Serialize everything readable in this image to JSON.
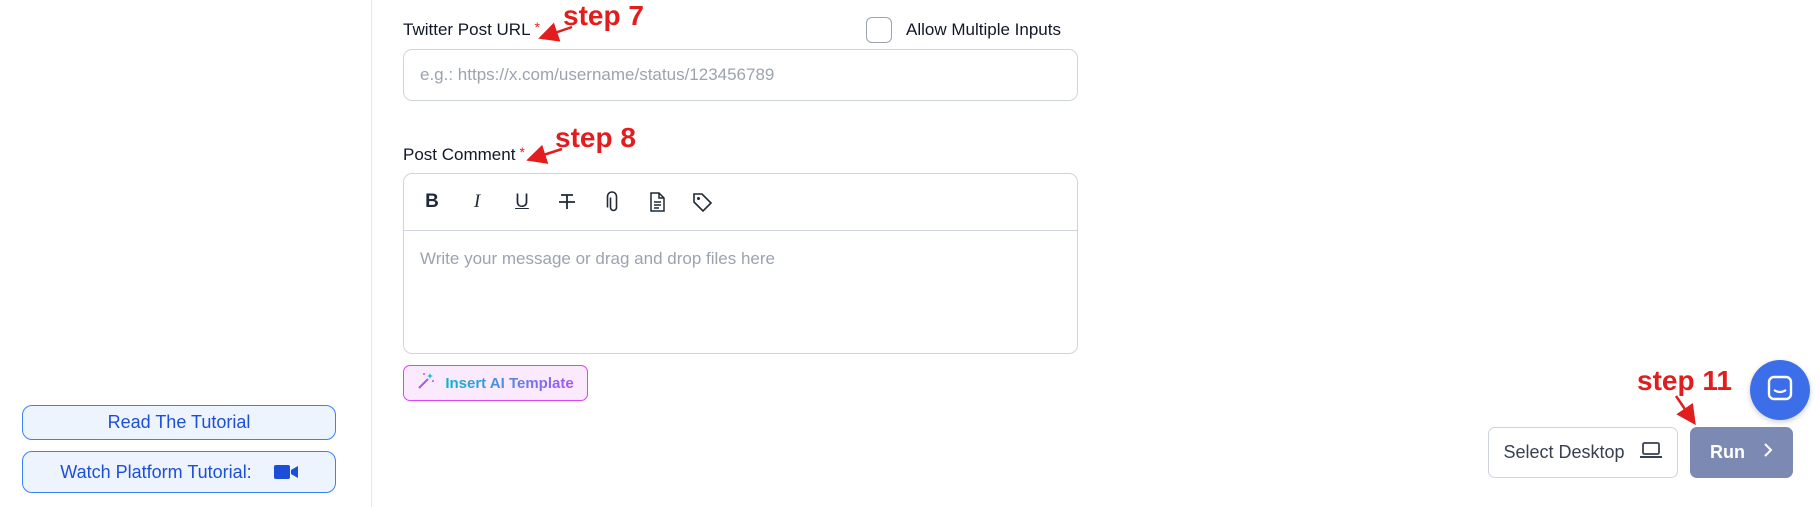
{
  "sidebar": {
    "read_tutorial_label": "Read The Tutorial",
    "watch_platform_label": "Watch Platform Tutorial:"
  },
  "form": {
    "url_label": "Twitter Post URL",
    "required_mark": "*",
    "allow_multiple_label": "Allow Multiple Inputs",
    "allow_multiple_checked": false,
    "url_value": "",
    "url_placeholder": "e.g.: https://x.com/username/status/123456789",
    "comment_label": "Post Comment",
    "editor_placeholder": "Write your message or drag and drop files here",
    "toolbar": [
      "bold-icon",
      "italic-icon",
      "underline-icon",
      "strikethrough-icon",
      "paperclip-icon",
      "document-icon",
      "tag-icon"
    ],
    "ai_template_label": "Insert AI Template"
  },
  "annotations": {
    "step7": "step 7",
    "step8": "step 8",
    "step11": "step 11",
    "color": "#e11d1d"
  },
  "footer": {
    "select_desktop_label": "Select Desktop",
    "run_label": "Run"
  },
  "colors": {
    "accent_blue": "#3b82f6",
    "run_button": "#7c89b3",
    "chat_button": "#3b6ee8",
    "ai_border": "#d946ef"
  }
}
